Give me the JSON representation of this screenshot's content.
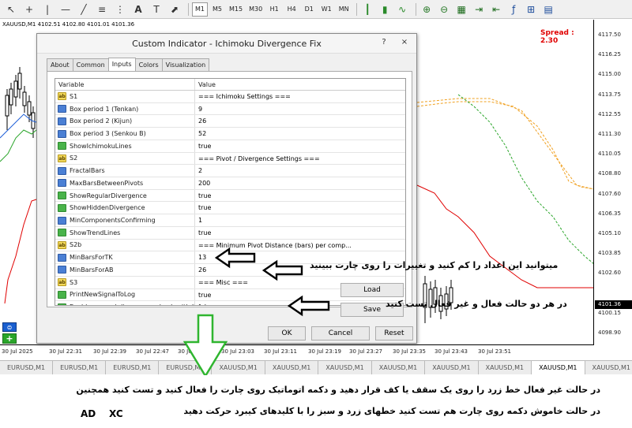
{
  "toolbar": {
    "timeframes": [
      "M1",
      "M5",
      "M15",
      "M30",
      "H1",
      "H4",
      "D1",
      "W1",
      "MN"
    ],
    "active_timeframe": "M1"
  },
  "chart": {
    "info": "XAUUSD,M1  4102.51  4102.80  4101.01  4101.36",
    "spread": "Spread : 2.30",
    "price_labels": [
      "4117.50",
      "4116.25",
      "4115.00",
      "4113.75",
      "4112.55",
      "4111.30",
      "4110.05",
      "4108.80",
      "4107.60",
      "4106.35",
      "4105.10",
      "4103.85",
      "4102.60",
      "4101.36",
      "4100.15",
      "4098.90"
    ],
    "current_price": "4101.36",
    "time_labels": [
      "30 Jul 2025",
      "30 Jul 22:31",
      "30 Jul 22:39",
      "30 Jul 22:47",
      "30 Jul 22:55",
      "30 Jul 23:03",
      "30 Jul 23:11",
      "30 Jul 23:19",
      "30 Jul 23:27",
      "30 Jul 23:35",
      "30 Jul 23:43",
      "30 Jul 23:51"
    ]
  },
  "symbol_tabs": [
    "EURUSD,M1",
    "EURUSD,M1",
    "EURUSD,M1",
    "EURUSD,M1",
    "XAUUSD,M1",
    "XAUUSD,M1",
    "XAUUSD,M1",
    "XAUUSD,M1",
    "XAUUSD,M1",
    "XAUUSD,M1",
    "XAUUSD,M1",
    "XAUUSD,M1"
  ],
  "active_symbol_tab": 10,
  "dialog": {
    "title": "Custom Indicator - Ichimoku Divergence Fix",
    "help": "?",
    "close": "×",
    "tabs": [
      "About",
      "Common",
      "Inputs",
      "Colors",
      "Visualization"
    ],
    "active_tab": "Inputs",
    "columns": {
      "variable": "Variable",
      "value": "Value"
    },
    "params": [
      {
        "type": "ab",
        "name": "S1",
        "value": "=== Ichimoku Settings ==="
      },
      {
        "type": "int",
        "name": "Box period 1 (Tenkan)",
        "value": "9"
      },
      {
        "type": "int",
        "name": "Box period 2 (Kijun)",
        "value": "26"
      },
      {
        "type": "int",
        "name": "Box period 3 (Senkou B)",
        "value": "52"
      },
      {
        "type": "bool",
        "name": "ShowIchimokuLines",
        "value": "true"
      },
      {
        "type": "ab",
        "name": "S2",
        "value": "=== Pivot / Divergence Settings ==="
      },
      {
        "type": "int",
        "name": "FractalBars",
        "value": "2"
      },
      {
        "type": "int",
        "name": "MaxBarsBetweenPivots",
        "value": "200"
      },
      {
        "type": "bool",
        "name": "ShowRegularDivergence",
        "value": "true"
      },
      {
        "type": "bool",
        "name": "ShowHiddenDivergence",
        "value": "true"
      },
      {
        "type": "int",
        "name": "MinComponentsConfirming",
        "value": "1"
      },
      {
        "type": "bool",
        "name": "ShowTrendLines",
        "value": "true"
      },
      {
        "type": "ab",
        "name": "S2b",
        "value": "=== Minimum Pivot Distance (bars) per comp..."
      },
      {
        "type": "int",
        "name": "MinBarsForTK",
        "value": "13"
      },
      {
        "type": "int",
        "name": "MinBarsForAB",
        "value": "26"
      },
      {
        "type": "ab",
        "name": "S3",
        "value": "=== Misc ==="
      },
      {
        "type": "bool",
        "name": "PrintNewSignalToLog",
        "value": "true"
      },
      {
        "type": "bool",
        "name": "Enable manual divergence check with li...",
        "value": "false"
      }
    ],
    "buttons": {
      "load": "Load",
      "save": "Save",
      "ok": "OK",
      "cancel": "Cancel",
      "reset": "Reset"
    }
  },
  "annotations": {
    "arrow1_text": "میتوانید این اعداد را کم کنید و تغییرات را روی چارت ببینید",
    "arrow2_text": "در هر دو حالت فعال و غیر فعال تست کنید"
  },
  "notes": {
    "line1": "در حالت غیر فعال خط زرد را روی یک سقف یا کف قرار دهید و دکمه اتوماتیک روی چارت را فعال کنید و تست کنید همچنین",
    "line2": "در حالت خاموش دکمه روی چارت هم تست کنید خطهای زرد و سبز را با کلیدهای کیبرد حرکت دهید",
    "key1": "AD",
    "key2": "XC"
  },
  "colors": {
    "tenkan": "#e00000",
    "kijun": "#1e5fd8",
    "senkou_a": "#f0a020",
    "senkou_b": "#f0a020",
    "chikou": "#2aa52a",
    "arrow_green": "#2fb52f"
  }
}
